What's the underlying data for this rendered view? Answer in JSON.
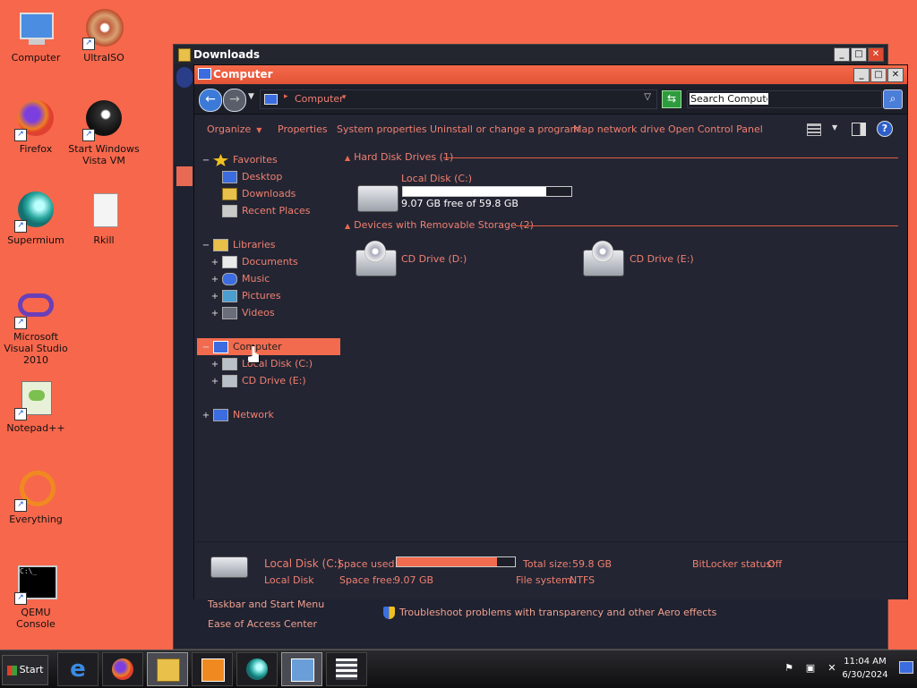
{
  "desktop": {
    "icons": [
      {
        "label": "Computer",
        "icon": "computer-icon"
      },
      {
        "label": "UltraISO",
        "icon": "ultraiso-icon"
      },
      {
        "label": "Firefox",
        "icon": "firefox-icon"
      },
      {
        "label": "Start Windows Vista VM",
        "icon": "vm-icon"
      },
      {
        "label": "Supermium",
        "icon": "supermium-icon"
      },
      {
        "label": "Rkill",
        "icon": "file-icon"
      },
      {
        "label": "Microsoft Visual Studio 2010",
        "icon": "visual-studio-icon"
      },
      {
        "label": "Notepad++",
        "icon": "notepadpp-icon"
      },
      {
        "label": "Everything",
        "icon": "everything-icon"
      },
      {
        "label": "QEMU Console",
        "icon": "console-icon"
      }
    ]
  },
  "back_window": {
    "title": "Downloads",
    "bottom_links": [
      "Taskbar and Start Menu",
      "Ease of Access Center"
    ],
    "aero_link": "Troubleshoot problems with transparency and other Aero effects"
  },
  "window": {
    "title": "Computer",
    "address": {
      "crumb": "Computer"
    },
    "search": {
      "placeholder": "Search Computer"
    },
    "toolbar": {
      "organize": "Organize",
      "properties": "Properties",
      "system_properties": "System properties",
      "uninstall": "Uninstall or change a program",
      "map_drive": "Map network drive",
      "control_panel": "Open Control Panel"
    },
    "nav": {
      "favorites": "Favorites",
      "desktop": "Desktop",
      "downloads": "Downloads",
      "recent": "Recent Places",
      "libraries": "Libraries",
      "documents": "Documents",
      "music": "Music",
      "pictures": "Pictures",
      "videos": "Videos",
      "computer": "Computer",
      "local_disk": "Local Disk (C:)",
      "cd_drive": "CD Drive (E:)",
      "network": "Network"
    },
    "content": {
      "hdd_header": "Hard Disk Drives (1)",
      "removable_header": "Devices with Removable Storage (2)",
      "local_disk_name": "Local Disk (C:)",
      "local_disk_free": "9.07 GB free of 59.8 GB",
      "local_disk_used_fraction": 0.85,
      "cd_d": "CD Drive (D:)",
      "cd_e": "CD Drive (E:)"
    },
    "details": {
      "name": "Local Disk (C:)",
      "type": "Local Disk",
      "space_used_label": "Space used:",
      "space_free_label": "Space free:",
      "space_free_value": "9.07 GB",
      "total_size_label": "Total size:",
      "total_size_value": "59.8 GB",
      "file_system_label": "File system:",
      "file_system_value": "NTFS",
      "bitlocker_label": "BitLocker status:",
      "bitlocker_value": "Off",
      "used_fraction": 0.85
    }
  },
  "taskbar": {
    "start": "Start",
    "apps": [
      "internet-explorer-icon",
      "firefox-icon",
      "explorer-icon",
      "media-player-icon",
      "supermium-icon",
      "control-panel-icon",
      "list-icon"
    ],
    "time": "11:04 AM",
    "date": "6/30/2024"
  },
  "colors": {
    "desktop": "#f7674c",
    "accent": "#f26b4e",
    "window_bg": "#232533"
  }
}
